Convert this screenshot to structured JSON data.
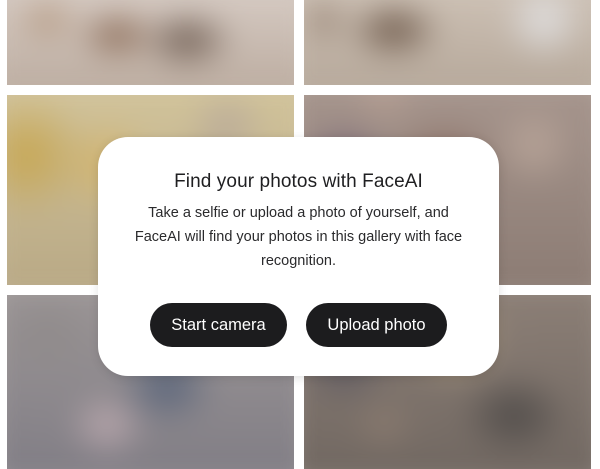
{
  "modal": {
    "title": "Find your photos with FaceAI",
    "description": "Take a selfie or upload a photo of yourself, and FaceAI will find your photos in this gallery with face recognition.",
    "start_camera_label": "Start camera",
    "upload_photo_label": "Upload photo"
  },
  "colors": {
    "button_background": "#1c1c1e",
    "button_text": "#ffffff",
    "card_background": "#ffffff"
  }
}
